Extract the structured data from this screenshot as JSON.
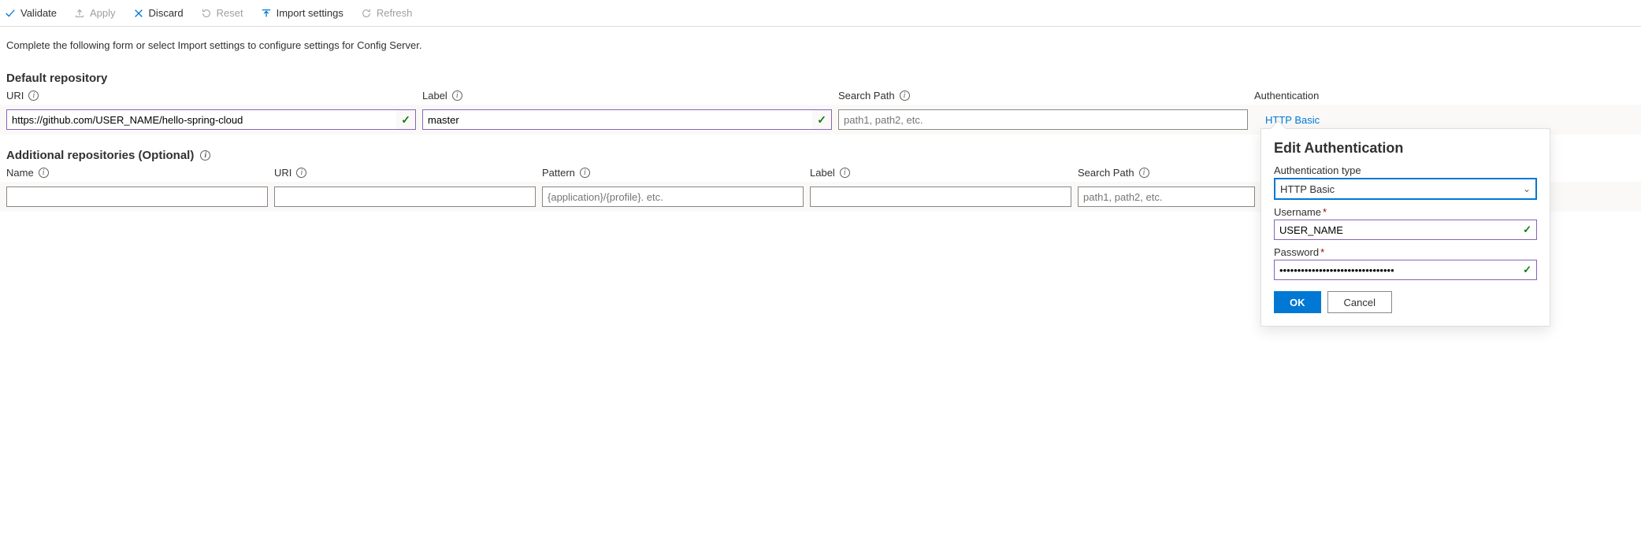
{
  "toolbar": {
    "validate": "Validate",
    "apply": "Apply",
    "discard": "Discard",
    "reset": "Reset",
    "import": "Import settings",
    "refresh": "Refresh"
  },
  "helper_text": "Complete the following form or select Import settings to configure settings for Config Server.",
  "default_repo": {
    "heading": "Default repository",
    "uri_label": "URI",
    "label_label": "Label",
    "searchpath_label": "Search Path",
    "auth_label": "Authentication",
    "uri_value": "https://github.com/USER_NAME/hello-spring-cloud",
    "label_value": "master",
    "searchpath_placeholder": "path1, path2, etc.",
    "auth_link": "HTTP Basic"
  },
  "additional": {
    "heading": "Additional repositories (Optional)",
    "name_label": "Name",
    "uri_label": "URI",
    "pattern_label": "Pattern",
    "label_label": "Label",
    "searchpath_label": "Search Path",
    "pattern_placeholder": "{application}/{profile}. etc.",
    "searchpath_placeholder": "path1, path2, etc."
  },
  "popover": {
    "title": "Edit Authentication",
    "type_label": "Authentication type",
    "type_value": "HTTP Basic",
    "username_label": "Username",
    "username_value": "USER_NAME",
    "password_label": "Password",
    "password_value": "••••••••••••••••••••••••••••••••",
    "ok": "OK",
    "cancel": "Cancel"
  }
}
